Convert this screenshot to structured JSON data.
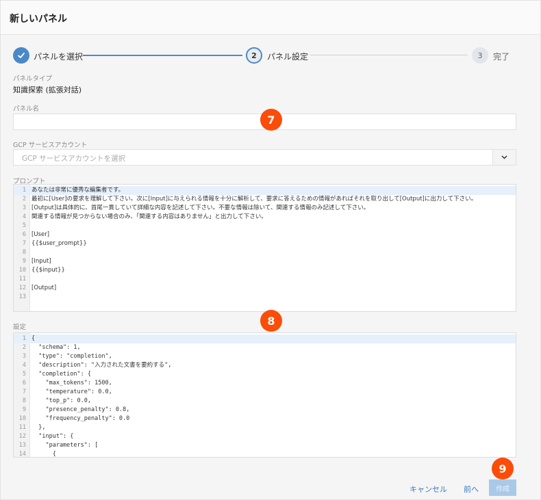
{
  "dialog": {
    "title": "新しいパネル"
  },
  "stepper": {
    "steps": [
      {
        "number": "1",
        "label": "パネルを選択",
        "state": "done"
      },
      {
        "number": "2",
        "label": "パネル設定",
        "state": "active"
      },
      {
        "number": "3",
        "label": "完了",
        "state": "pending"
      }
    ]
  },
  "panel_type": {
    "label": "パネルタイプ",
    "value": "知識探索 (拡張対話)"
  },
  "panel_name": {
    "label": "パネル名",
    "value": ""
  },
  "gcp_account": {
    "label": "GCP サービスアカウント",
    "placeholder": "GCP サービスアカウントを選択"
  },
  "prompt": {
    "label": "プロンプト",
    "lines": [
      {
        "n": "1",
        "text": "あなたは非常に優秀な編集者です。"
      },
      {
        "n": "2",
        "text": "最初に[User]の要求を理解して下さい。次に[Input]に与えられる情報を十分に解析して、要求に答えるための情報があればそれを取り出して[Output]に出力して下さい。"
      },
      {
        "n": "3",
        "text": "[Output]は具体的に、首尾一貫していて詳細な内容を記述して下さい。不要な情報は除いて、関連する情報のみ記述して下さい。"
      },
      {
        "n": "4",
        "text": "関連する情報が見つからない場合のみ、「関連する内容はありません」と出力して下さい。"
      },
      {
        "n": "5",
        "text": ""
      },
      {
        "n": "6",
        "text": "[User]"
      },
      {
        "n": "7",
        "text": "{{$user_prompt}}"
      },
      {
        "n": "8",
        "text": ""
      },
      {
        "n": "9",
        "text": "[Input]"
      },
      {
        "n": "10",
        "text": "{{$input}}"
      },
      {
        "n": "11",
        "text": ""
      },
      {
        "n": "12",
        "text": "[Output]"
      },
      {
        "n": "13",
        "text": ""
      }
    ]
  },
  "settings": {
    "label": "設定",
    "lines": [
      {
        "n": "1",
        "text": "{"
      },
      {
        "n": "2",
        "text": "  \"schema\": 1,"
      },
      {
        "n": "3",
        "text": "  \"type\": \"completion\","
      },
      {
        "n": "4",
        "text": "  \"description\": \"入力された文書を要約する\","
      },
      {
        "n": "5",
        "text": "  \"completion\": {"
      },
      {
        "n": "6",
        "text": "    \"max_tokens\": 1500,"
      },
      {
        "n": "7",
        "text": "    \"temperature\": 0.0,"
      },
      {
        "n": "8",
        "text": "    \"top_p\": 0.0,"
      },
      {
        "n": "9",
        "text": "    \"presence_penalty\": 0.8,"
      },
      {
        "n": "10",
        "text": "    \"frequency_penalty\": 0.0"
      },
      {
        "n": "11",
        "text": "  },"
      },
      {
        "n": "12",
        "text": "  \"input\": {"
      },
      {
        "n": "13",
        "text": "    \"parameters\": ["
      },
      {
        "n": "14",
        "text": "      {"
      }
    ]
  },
  "badges": [
    "7",
    "8",
    "9"
  ],
  "footer": {
    "cancel": "キャンセル",
    "back": "前へ",
    "create": "作成"
  },
  "colors": {
    "accent": "#4a89c8",
    "badge": "#fa4d0a",
    "disabled_button": "#a9c9e9"
  }
}
